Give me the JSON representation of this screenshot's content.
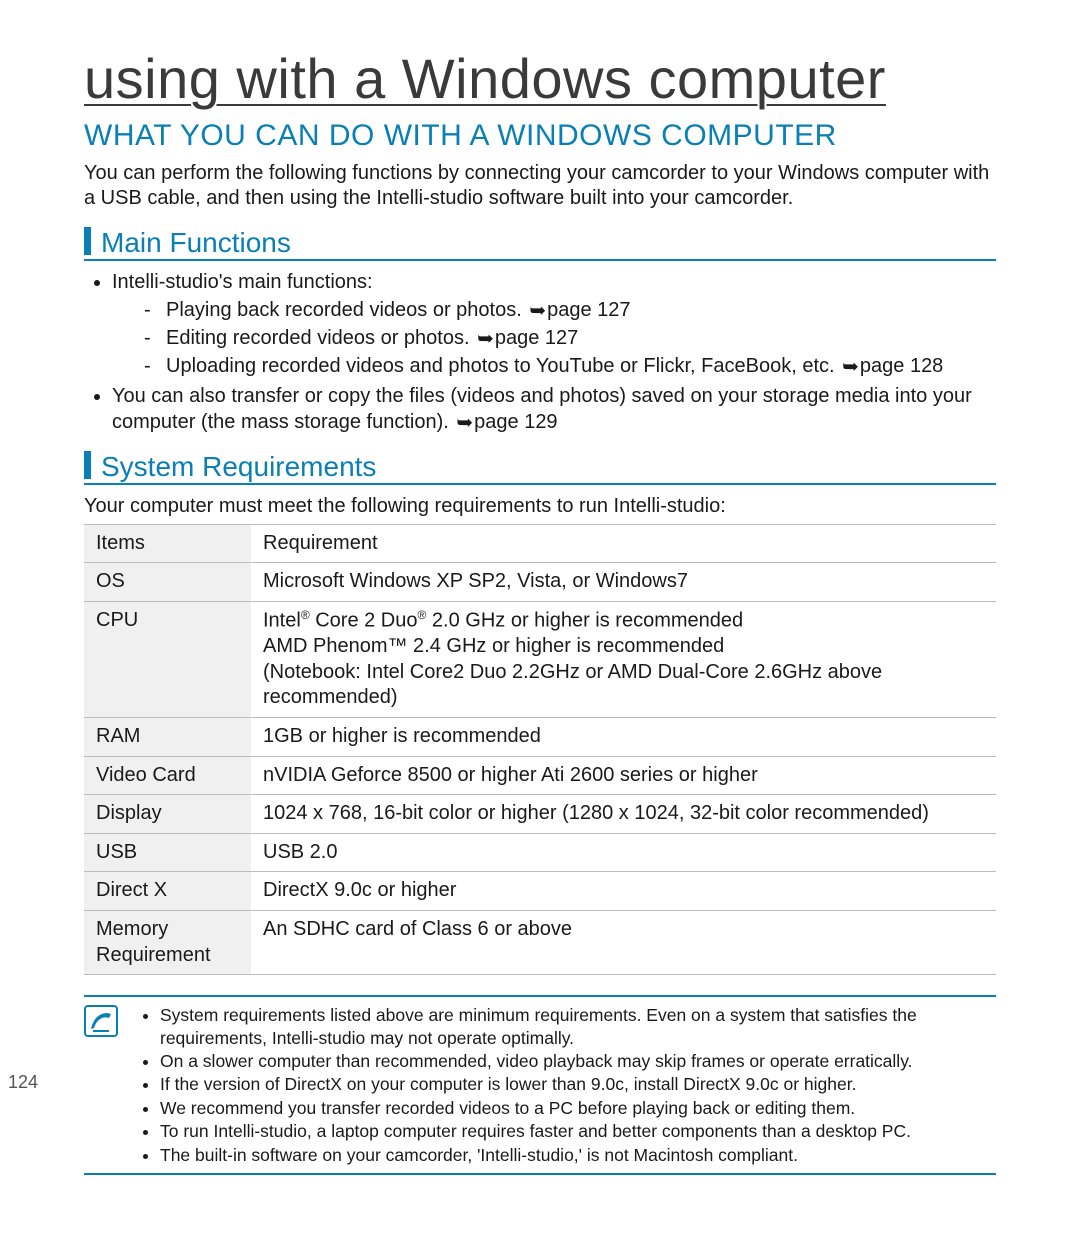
{
  "page_number": "124",
  "chapter_title": "using with a Windows computer",
  "section_title": "WHAT YOU CAN DO WITH A WINDOWS COMPUTER",
  "intro": "You can perform the following functions by connecting your camcorder to your Windows computer with a USB cable, and then using the Intelli-studio software built into your camcorder.",
  "sub_main": "Main Functions",
  "sub_sys": "System Requirements",
  "mf_intro": "Intelli-studio's main functions:",
  "mf_items": [
    {
      "text": "Playing back recorded videos or photos. ",
      "page": "page 127"
    },
    {
      "text": "Editing recorded videos or photos. ",
      "page": "page 127"
    },
    {
      "text": "Uploading recorded videos and photos to YouTube or Flickr, FaceBook, etc. ",
      "page": "page 128"
    }
  ],
  "mf_extra": {
    "text": "You can also transfer or copy the files (videos and photos) saved on your storage media into your computer (the mass storage function). ",
    "page": "page 129"
  },
  "req_intro": "Your computer must meet the following requirements to run Intelli-studio:",
  "table_header": {
    "items": "Items",
    "req": "Requirement"
  },
  "table": [
    {
      "label": "OS",
      "value_html": "Microsoft Windows XP SP2, Vista, or Windows7"
    },
    {
      "label": "CPU",
      "value_html": "Intel<sup>®</sup> Core 2 Duo<sup>®</sup> 2.0 GHz or higher is recommended<br>AMD Phenom™ 2.4 GHz or higher is recommended<br>(Notebook: Intel Core2 Duo 2.2GHz or AMD Dual-Core 2.6GHz above recommended)"
    },
    {
      "label": "RAM",
      "value_html": "1GB or higher is recommended"
    },
    {
      "label": "Video Card",
      "value_html": "nVIDIA Geforce 8500 or higher Ati 2600 series or higher"
    },
    {
      "label": "Display",
      "value_html": "1024 x 768, 16-bit color or higher (1280 x 1024, 32-bit color recommended)"
    },
    {
      "label": "USB",
      "value_html": "USB 2.0"
    },
    {
      "label": "Direct X",
      "value_html": "DirectX 9.0c or higher"
    },
    {
      "label": "Memory Requirement",
      "value_html": "An SDHC card of Class 6 or above"
    }
  ],
  "notes": [
    "System requirements listed above are minimum requirements. Even on a system that satisfies the requirements, Intelli-studio may not operate optimally.",
    "On a slower computer than recommended, video playback may skip frames or operate erratically.",
    "If the version of DirectX on your computer is lower than 9.0c, install DirectX 9.0c or higher.",
    "We recommend you transfer recorded videos to a PC before playing back or editing them.",
    "To run Intelli-studio, a laptop computer requires faster and better components than a desktop PC.",
    "The built-in software on your camcorder, 'Intelli-studio,' is not Macintosh compliant."
  ],
  "arrow_glyph": "➥"
}
